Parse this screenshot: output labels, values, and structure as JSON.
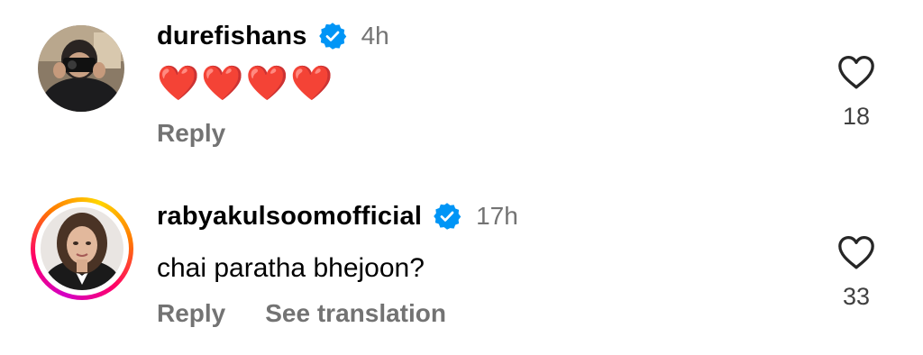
{
  "comments": [
    {
      "username": "durefishans",
      "verified": true,
      "timestamp": "4h",
      "text": "❤️❤️❤️❤️",
      "actions": [
        "Reply"
      ],
      "like_count": "18",
      "avatar_ring": false
    },
    {
      "username": "rabyakulsoomofficial",
      "verified": true,
      "timestamp": "17h",
      "text": "chai paratha bhejoon?",
      "actions": [
        "Reply",
        "See translation"
      ],
      "like_count": "33",
      "avatar_ring": true
    }
  ],
  "colors": {
    "verified_badge": "#0095f6",
    "secondary_text": "#737373",
    "story_ring_start": "#d300c5",
    "story_ring_end": "#ffd600"
  },
  "icons": {
    "verified": "verified-badge-icon",
    "like": "heart-outline-icon"
  }
}
